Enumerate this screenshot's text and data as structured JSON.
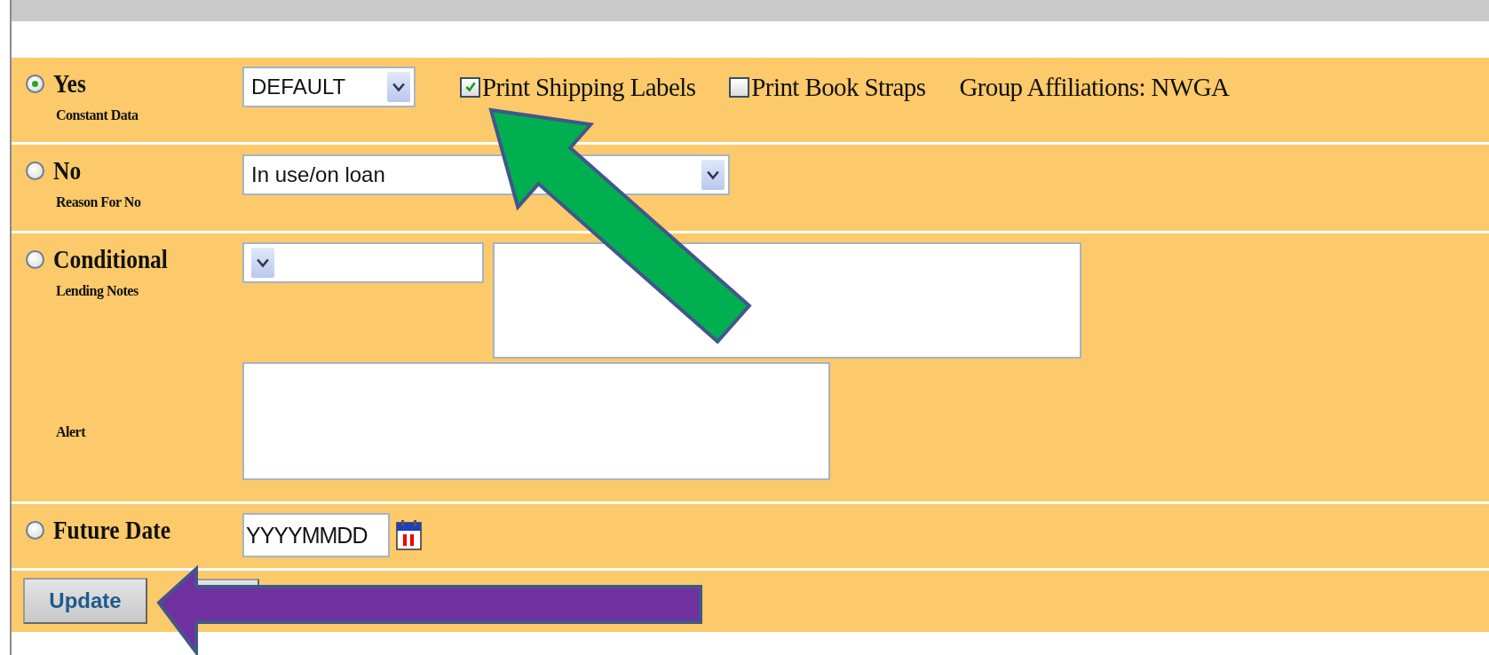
{
  "options": [
    {
      "label": "Yes",
      "sublabel": "Constant Data",
      "selected": true
    },
    {
      "label": "No",
      "sublabel": "Reason For No",
      "selected": false
    },
    {
      "label": "Conditional",
      "sublabel": "Lending Notes",
      "selected": false
    },
    {
      "label": "Future Date",
      "selected": false
    }
  ],
  "profile_select": {
    "value": "DEFAULT"
  },
  "checkboxes": [
    {
      "label": "Print Shipping Labels",
      "checked": true
    },
    {
      "label": "Print Book Straps",
      "checked": false
    }
  ],
  "group_affiliations": "Group Affiliations: NWGA",
  "reason_select": {
    "value": "In use/on loan"
  },
  "alert_label": "Alert",
  "date_field": {
    "value": "YYYYMMDD"
  },
  "buttons": [
    {
      "label": "Update"
    }
  ]
}
